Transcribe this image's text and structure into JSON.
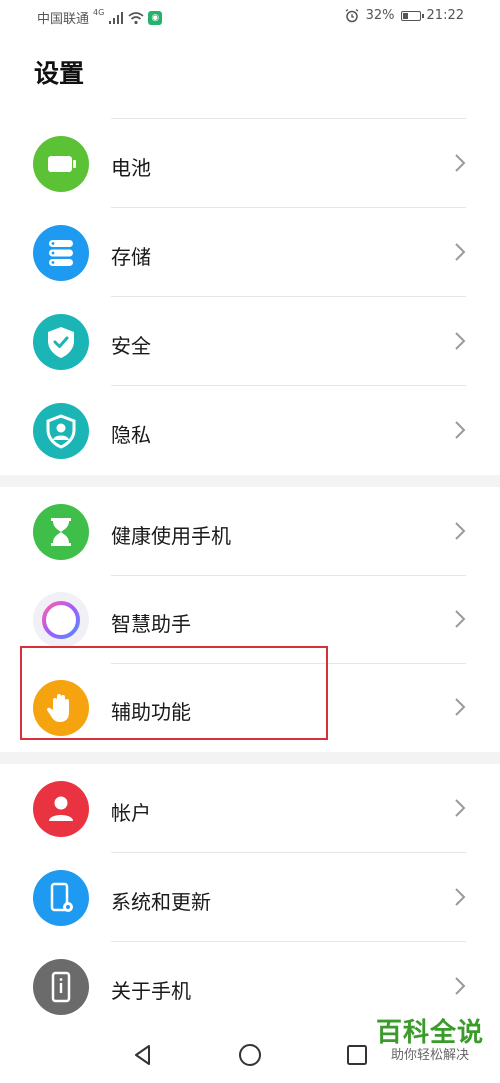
{
  "status_bar": {
    "carrier": "中国联通",
    "network": "4G",
    "battery_percent": "32%",
    "time": "21:22"
  },
  "page_title": "设置",
  "groups": [
    {
      "items": [
        {
          "label": "电池",
          "icon": "battery-icon",
          "color": "#5bc236"
        },
        {
          "label": "存储",
          "icon": "storage-icon",
          "color": "#1e9bf0"
        },
        {
          "label": "安全",
          "icon": "shield-check-icon",
          "color": "#1bb5b5"
        },
        {
          "label": "隐私",
          "icon": "privacy-icon",
          "color": "#1bb5b5"
        }
      ]
    },
    {
      "items": [
        {
          "label": "健康使用手机",
          "icon": "hourglass-icon",
          "color": "#3fbf4a"
        },
        {
          "label": "智慧助手",
          "icon": "assistant-ring-icon",
          "color": "#f0f0f5"
        },
        {
          "label": "辅助功能",
          "icon": "hand-icon",
          "color": "#f5a30f"
        }
      ]
    },
    {
      "items": [
        {
          "label": "帐户",
          "icon": "account-icon",
          "color": "#ea3340"
        },
        {
          "label": "系统和更新",
          "icon": "system-update-icon",
          "color": "#1e9bf0"
        },
        {
          "label": "关于手机",
          "icon": "phone-info-icon",
          "color": "#6b6b6b"
        }
      ]
    }
  ],
  "watermark": {
    "title": "百科全说",
    "subtitle": "助你轻松解决"
  }
}
